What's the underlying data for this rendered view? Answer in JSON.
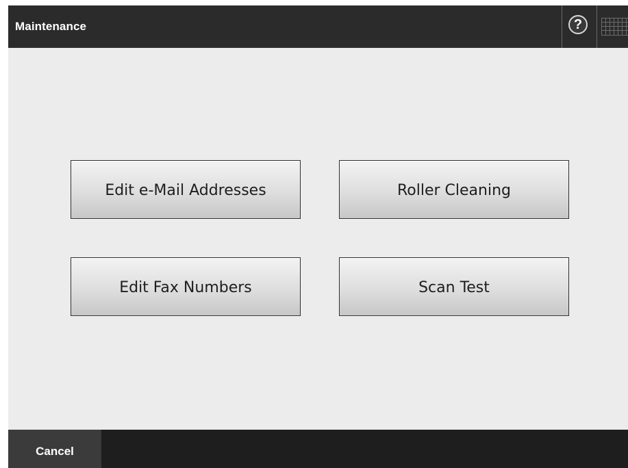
{
  "header": {
    "title": "Maintenance",
    "help_icon_glyph": "?",
    "icons": [
      "help-icon",
      "keyboard-icon"
    ]
  },
  "menu": {
    "edit_email": "Edit e-Mail Addresses",
    "roller_cleaning": "Roller Cleaning",
    "edit_fax": "Edit Fax Numbers",
    "scan_test": "Scan Test"
  },
  "footer": {
    "cancel_label": "Cancel"
  },
  "colors": {
    "titlebar": "#2b2b2b",
    "body": "#ececec",
    "footer": "#1e1e1e",
    "cancel_button": "#3b3b3b"
  }
}
